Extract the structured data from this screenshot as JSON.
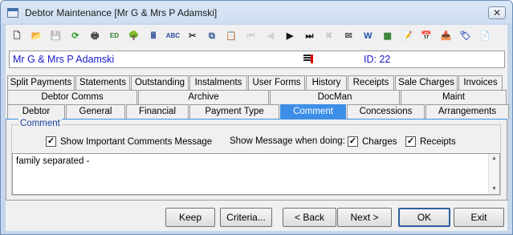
{
  "window": {
    "title": "Debtor Maintenance  [Mr G & Mrs P Adamski]",
    "close_glyph": "✕"
  },
  "toolbar": {
    "icons": [
      {
        "name": "new-document-icon",
        "glyph": "🗋",
        "color": "#333"
      },
      {
        "name": "open-folder-icon",
        "glyph": "📂",
        "color": "#c9901a"
      },
      {
        "name": "save-icon",
        "glyph": "💾",
        "color": "#555",
        "dim": true
      },
      {
        "name": "refresh-icon",
        "glyph": "⟳",
        "color": "#2a9a2a"
      },
      {
        "name": "print-icon",
        "glyph": "🖶",
        "color": "#444"
      },
      {
        "name": "edit-icon",
        "glyph": "ED",
        "color": "#2a7a2a"
      },
      {
        "name": "tree-icon",
        "glyph": "🌳",
        "color": "#2a8a2a"
      },
      {
        "name": "calculator-icon",
        "glyph": "🖩",
        "color": "#3a5a9a"
      },
      {
        "name": "spellcheck-icon",
        "glyph": "ABC",
        "color": "#2a4aa0"
      },
      {
        "name": "cut-icon",
        "glyph": "✂",
        "color": "#333"
      },
      {
        "name": "copy-icon",
        "glyph": "⧉",
        "color": "#3a5a9a"
      },
      {
        "name": "paste-icon",
        "glyph": "📋",
        "color": "#b07a20"
      },
      {
        "name": "first-record-icon",
        "glyph": "⏮",
        "color": "#999",
        "dim": true
      },
      {
        "name": "previous-record-icon",
        "glyph": "◀",
        "color": "#999",
        "dim": true
      },
      {
        "name": "next-record-icon",
        "glyph": "▶",
        "color": "#111"
      },
      {
        "name": "last-record-icon",
        "glyph": "⏭",
        "color": "#111"
      },
      {
        "name": "delete-icon",
        "glyph": "✖",
        "color": "#888",
        "dim": true
      },
      {
        "name": "email-icon",
        "glyph": "✉",
        "color": "#555"
      },
      {
        "name": "word-icon",
        "glyph": "W",
        "color": "#1c4fb0"
      },
      {
        "name": "grid-icon",
        "glyph": "▦",
        "color": "#2a7a2a"
      },
      {
        "name": "notes-icon",
        "glyph": "📝",
        "color": "#b07a20"
      },
      {
        "name": "calendar-icon",
        "glyph": "📅",
        "color": "#444"
      },
      {
        "name": "inbox-icon",
        "glyph": "📥",
        "color": "#b02020"
      },
      {
        "name": "tag-icon",
        "glyph": "🏷",
        "color": "#3a5ac0"
      },
      {
        "name": "add-note-icon",
        "glyph": "📄",
        "color": "#b07a20"
      }
    ]
  },
  "debtor": {
    "name": "Mr G & Mrs P Adamski",
    "id_label": "ID: 22"
  },
  "tabs": {
    "row1": [
      {
        "name": "tab-split-payments",
        "label": "Split Payments",
        "w": 84
      },
      {
        "name": "tab-statements",
        "label": "Statements",
        "w": 68
      },
      {
        "name": "tab-outstanding",
        "label": "Outstanding",
        "w": 72
      },
      {
        "name": "tab-instalments",
        "label": "Instalments",
        "w": 72
      },
      {
        "name": "tab-user-forms",
        "label": "User Forms",
        "w": 71
      },
      {
        "name": "tab-history",
        "label": "History",
        "w": 51
      },
      {
        "name": "tab-receipts",
        "label": "Receipts",
        "w": 58
      },
      {
        "name": "tab-sale-charges",
        "label": "Sale Charges",
        "w": 78
      },
      {
        "name": "tab-invoices",
        "label": "Invoices",
        "w": 55
      }
    ],
    "row2": [
      {
        "name": "tab-debtor-comms",
        "label": "Debtor Comms",
        "w": 162
      },
      {
        "name": "tab-archive",
        "label": "Archive",
        "w": 163
      },
      {
        "name": "tab-docman",
        "label": "DocMan",
        "w": 162
      },
      {
        "name": "tab-maint",
        "label": "Maint",
        "w": 132
      }
    ],
    "row3": [
      {
        "name": "tab-debtor",
        "label": "Debtor",
        "w": 72
      },
      {
        "name": "tab-general",
        "label": "General",
        "w": 74
      },
      {
        "name": "tab-financial",
        "label": "Financial",
        "w": 78
      },
      {
        "name": "tab-payment-type",
        "label": "Payment Type",
        "w": 112
      },
      {
        "name": "tab-comment",
        "label": "Comment",
        "w": 82,
        "active": true
      },
      {
        "name": "tab-concessions",
        "label": "Concessions",
        "w": 97
      },
      {
        "name": "tab-arrangements",
        "label": "Arrangements",
        "w": 104
      }
    ]
  },
  "comment": {
    "group_label": "Comment",
    "show_important_label": "Show Important Comments Message",
    "show_important_checked": "✓",
    "show_when_label": "Show Message when doing:",
    "charges_label": "Charges",
    "charges_checked": "✓",
    "receipts_label": "Receipts",
    "receipts_checked": "✓",
    "text": "family separated -"
  },
  "buttons": {
    "keep": "Keep",
    "criteria": "Criteria...",
    "back": "< Back",
    "next": "Next >",
    "ok": "OK",
    "exit": "Exit"
  },
  "colors": {
    "active_tab": "#3d8ee6",
    "name_text": "#1a1acc",
    "group_label": "#1a3fa0"
  }
}
